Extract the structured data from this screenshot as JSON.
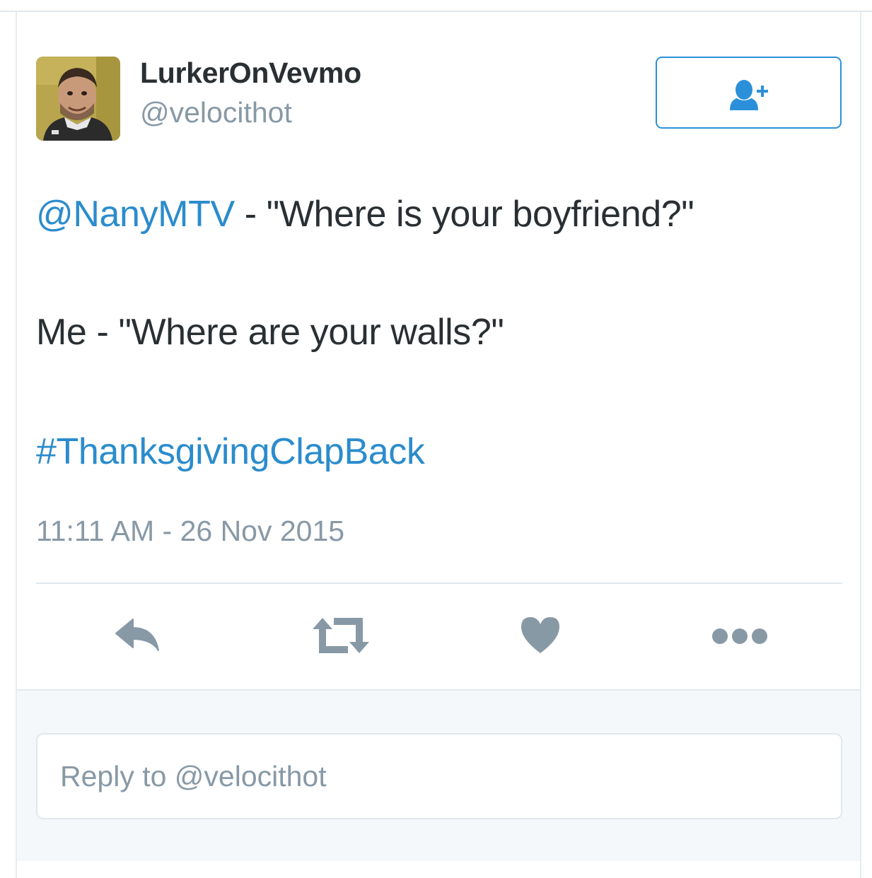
{
  "user": {
    "display_name": "LurkerOnVevmo",
    "handle": "@velocithot"
  },
  "follow_button": {
    "icon": "follow-person-plus-icon"
  },
  "tweet": {
    "line1": {
      "mention": "@NanyMTV",
      "text": " - \"Where is your boyfriend?\""
    },
    "line2": {
      "text": "Me - \"Where are your walls?\""
    },
    "line3": {
      "hashtag": "#ThanksgivingClapBack"
    },
    "timestamp": "11:11 AM - 26 Nov 2015"
  },
  "actions": [
    {
      "name": "reply",
      "icon": "reply-arrow-icon"
    },
    {
      "name": "retweet",
      "icon": "retweet-icon"
    },
    {
      "name": "like",
      "icon": "heart-icon"
    },
    {
      "name": "more",
      "icon": "more-dots-icon"
    }
  ],
  "reply_box": {
    "placeholder": "Reply to @velocithot"
  },
  "colors": {
    "link": "#2b8ccc",
    "button_border": "#2b90d9",
    "text": "#292f33",
    "muted": "#8899a6",
    "action_icon": "#8899a6",
    "reply_area_bg": "#f5f8fa"
  }
}
